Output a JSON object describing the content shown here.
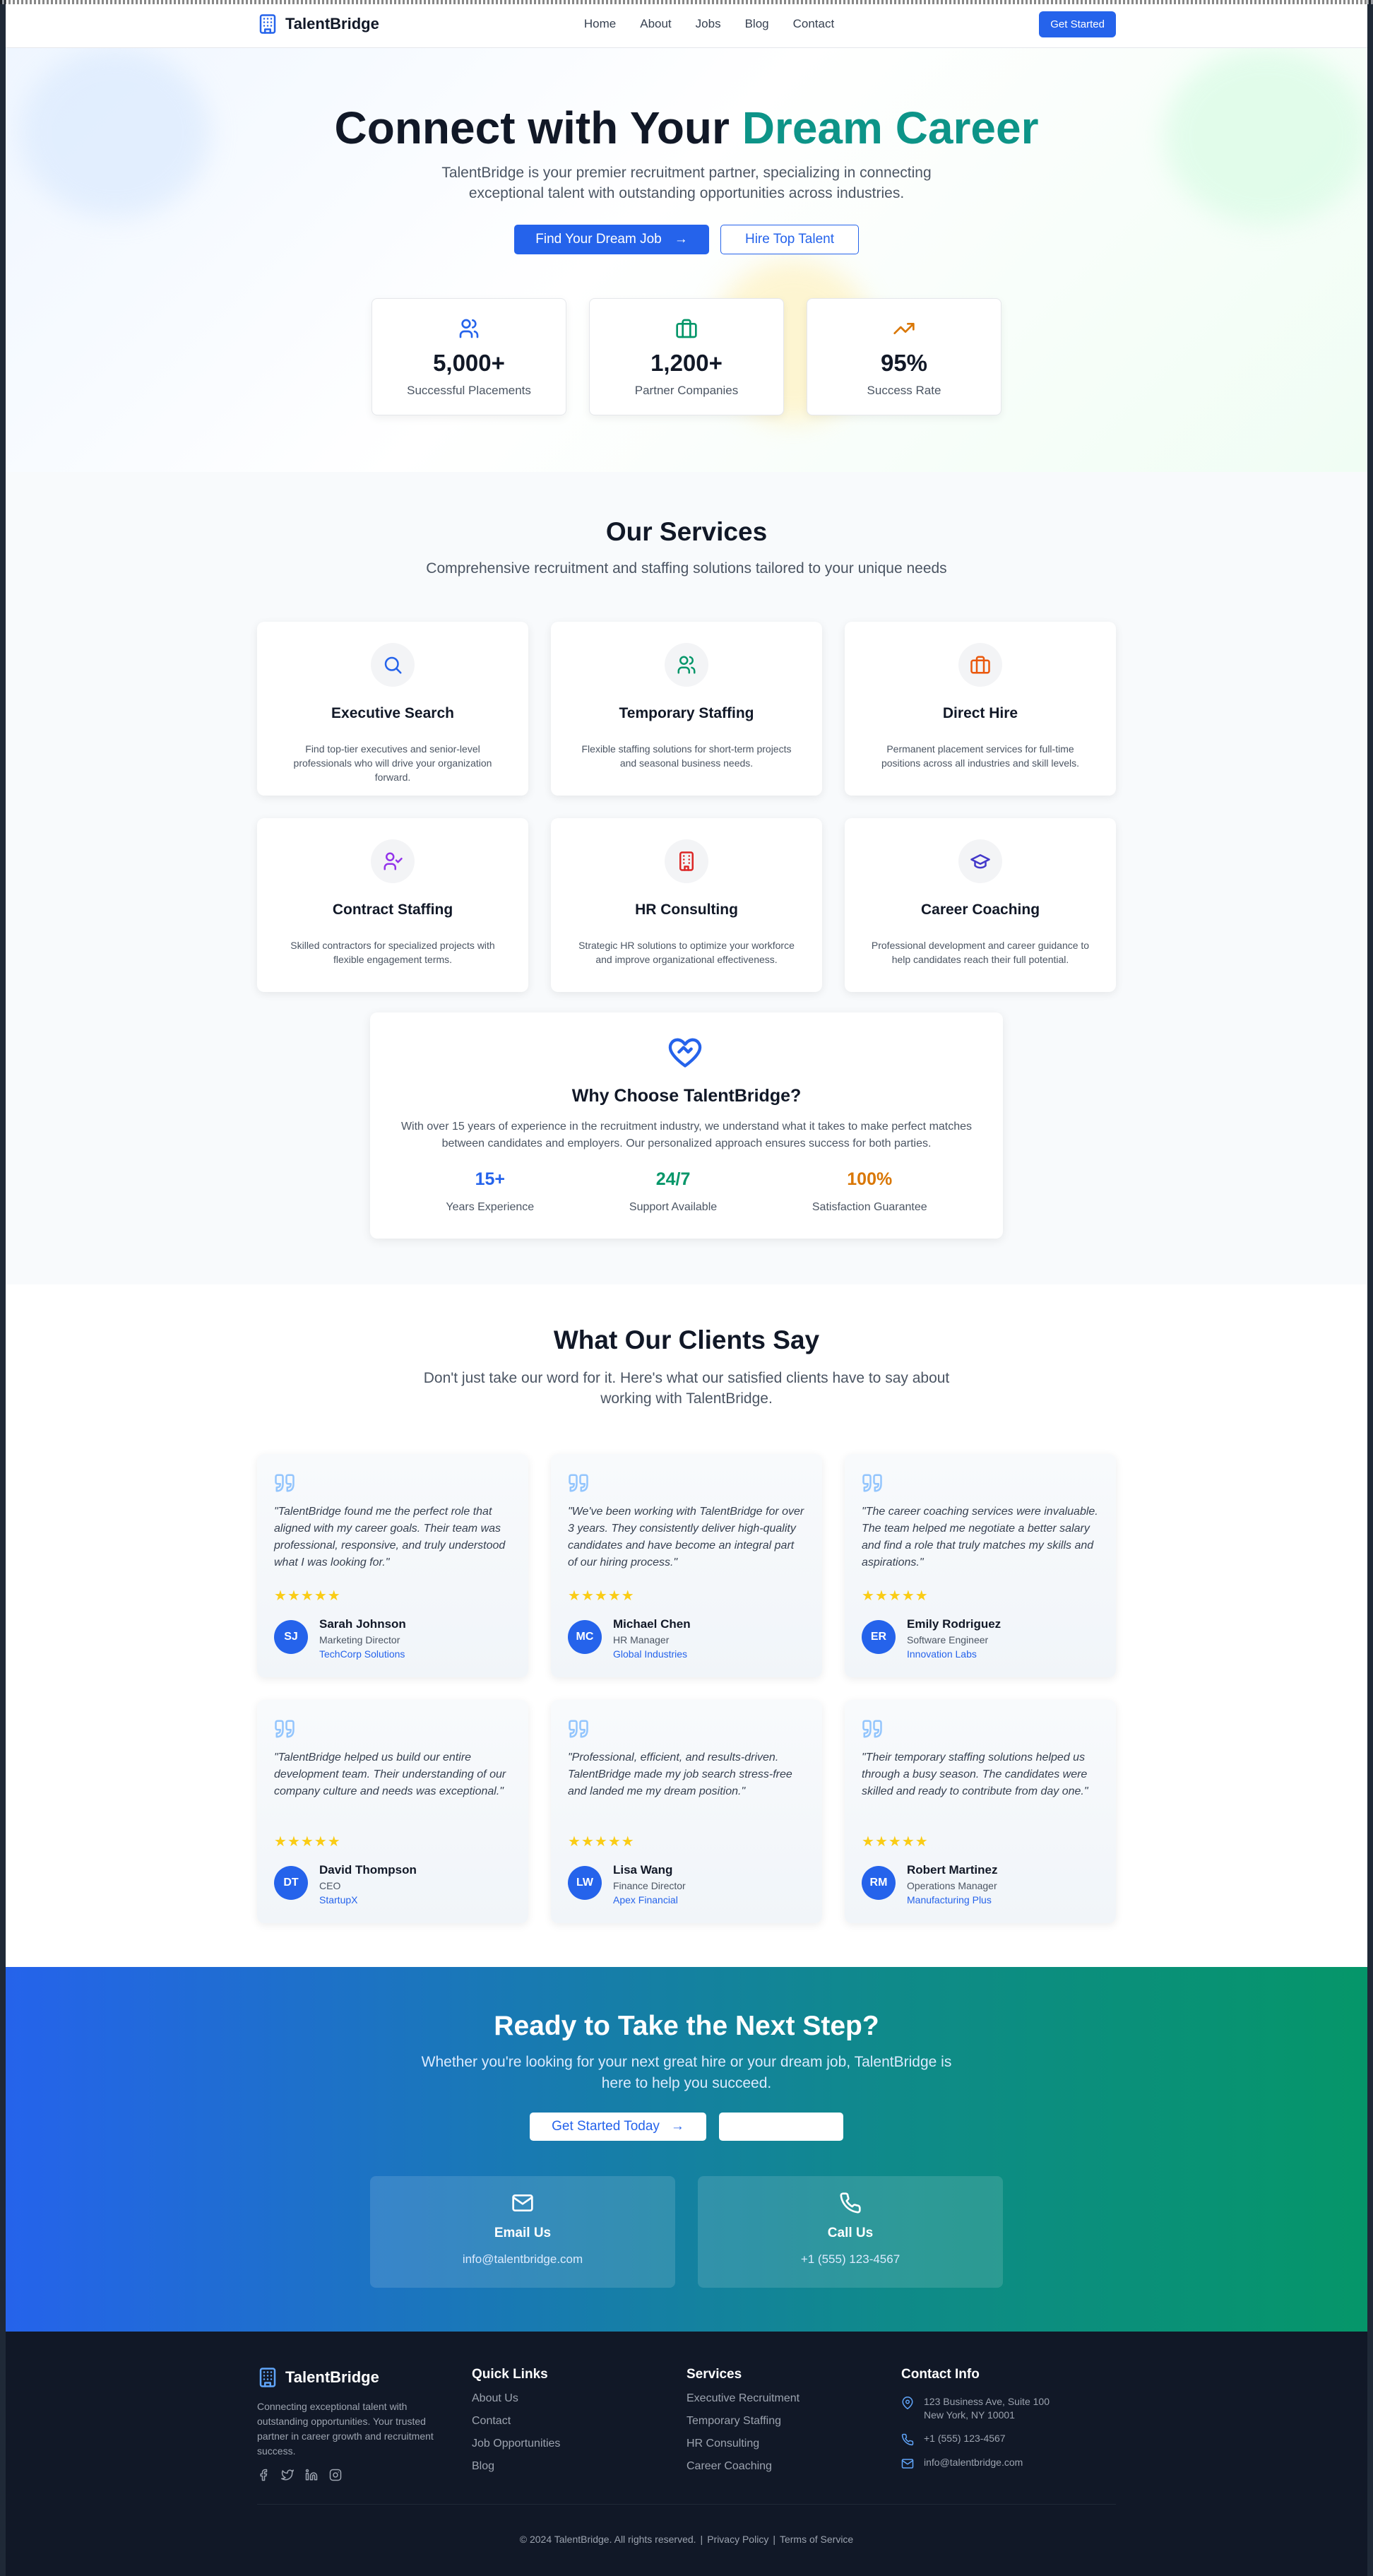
{
  "brand": "TalentBridge",
  "nav": {
    "links": [
      "Home",
      "About",
      "Jobs",
      "Blog",
      "Contact"
    ],
    "cta": "Get Started"
  },
  "hero": {
    "title_prefix": "Connect with Your ",
    "title_accent": "Dream Career",
    "subtitle": "TalentBridge is your premier recruitment partner, specializing in connecting exceptional talent with outstanding opportunities across industries.",
    "primary_cta": "Find Your Dream Job",
    "secondary_cta": "Hire Top Talent",
    "stats": [
      {
        "value": "5,000+",
        "label": "Successful Placements",
        "icon": "users-icon",
        "color": "#2563eb"
      },
      {
        "value": "1,200+",
        "label": "Partner Companies",
        "icon": "briefcase-icon",
        "color": "#059669"
      },
      {
        "value": "95%",
        "label": "Success Rate",
        "icon": "trending-up-icon",
        "color": "#d97706"
      }
    ]
  },
  "services": {
    "title": "Our Services",
    "subtitle": "Comprehensive recruitment and staffing solutions tailored to your unique needs",
    "items": [
      {
        "title": "Executive Search",
        "desc": "Find top-tier executives and senior-level professionals who will drive your organization forward.",
        "icon": "search-icon",
        "color": "#2563eb"
      },
      {
        "title": "Temporary Staffing",
        "desc": "Flexible staffing solutions for short-term projects and seasonal business needs.",
        "icon": "users-icon",
        "color": "#059669"
      },
      {
        "title": "Direct Hire",
        "desc": "Permanent placement services for full-time positions across all industries and skill levels.",
        "icon": "briefcase-icon",
        "color": "#ea580c"
      },
      {
        "title": "Contract Staffing",
        "desc": "Skilled contractors for specialized projects with flexible engagement terms.",
        "icon": "user-check-icon",
        "color": "#9333ea"
      },
      {
        "title": "HR Consulting",
        "desc": "Strategic HR solutions to optimize your workforce and improve organizational effectiveness.",
        "icon": "building-icon",
        "color": "#dc2626"
      },
      {
        "title": "Career Coaching",
        "desc": "Professional development and career guidance to help candidates reach their full potential.",
        "icon": "graduation-cap-icon",
        "color": "#4338ca"
      }
    ],
    "why": {
      "title": "Why Choose TalentBridge?",
      "text": "With over 15 years of experience in the recruitment industry, we understand what it takes to make perfect matches between candidates and employers. Our personalized approach ensures success for both parties.",
      "stats": [
        {
          "value": "15+",
          "label": "Years Experience",
          "color": "#2563eb"
        },
        {
          "value": "24/7",
          "label": "Support Available",
          "color": "#059669"
        },
        {
          "value": "100%",
          "label": "Satisfaction Guarantee",
          "color": "#d97706"
        }
      ]
    }
  },
  "testimonials": {
    "title": "What Our Clients Say",
    "subtitle": "Don't just take our word for it. Here's what our satisfied clients have to say about working with TalentBridge.",
    "items": [
      {
        "quote": "\"TalentBridge found me the perfect role that aligned with my career goals. Their team was professional, responsive, and truly understood what I was looking for.\"",
        "initials": "SJ",
        "name": "Sarah Johnson",
        "role": "Marketing Director",
        "company": "TechCorp Solutions",
        "rating": 5
      },
      {
        "quote": "\"We've been working with TalentBridge for over 3 years. They consistently deliver high-quality candidates and have become an integral part of our hiring process.\"",
        "initials": "MC",
        "name": "Michael Chen",
        "role": "HR Manager",
        "company": "Global Industries",
        "rating": 5
      },
      {
        "quote": "\"The career coaching services were invaluable. The team helped me negotiate a better salary and find a role that truly matches my skills and aspirations.\"",
        "initials": "ER",
        "name": "Emily Rodriguez",
        "role": "Software Engineer",
        "company": "Innovation Labs",
        "rating": 5
      },
      {
        "quote": "\"TalentBridge helped us build our entire development team. Their understanding of our company culture and needs was exceptional.\"",
        "initials": "DT",
        "name": "David Thompson",
        "role": "CEO",
        "company": "StartupX",
        "rating": 5
      },
      {
        "quote": "\"Professional, efficient, and results-driven. TalentBridge made my job search stress-free and landed me my dream position.\"",
        "initials": "LW",
        "name": "Lisa Wang",
        "role": "Finance Director",
        "company": "Apex Financial",
        "rating": 5
      },
      {
        "quote": "\"Their temporary staffing solutions helped us through a busy season. The candidates were skilled and ready to contribute from day one.\"",
        "initials": "RM",
        "name": "Robert Martinez",
        "role": "Operations Manager",
        "company": "Manufacturing Plus",
        "rating": 5
      }
    ]
  },
  "cta": {
    "title": "Ready to Take the Next Step?",
    "subtitle": "Whether you're looking for your next great hire or your dream job, TalentBridge is here to help you succeed.",
    "primary": "Get Started Today",
    "secondary": "",
    "contacts": [
      {
        "title": "Email Us",
        "value": "info@talentbridge.com",
        "icon": "mail-icon"
      },
      {
        "title": "Call Us",
        "value": "+1 (555) 123-4567",
        "icon": "phone-icon"
      }
    ]
  },
  "footer": {
    "description": "Connecting exceptional talent with outstanding opportunities. Your trusted partner in career growth and recruitment success.",
    "quick_links_title": "Quick Links",
    "quick_links": [
      "About Us",
      "Contact",
      "Job Opportunities",
      "Blog"
    ],
    "services_title": "Services",
    "services": [
      "Executive Recruitment",
      "Temporary Staffing",
      "HR Consulting",
      "Career Coaching"
    ],
    "contact_title": "Contact Info",
    "address_line1": "123 Business Ave, Suite 100",
    "address_line2": "New York, NY 10001",
    "phone": "+1 (555) 123-4567",
    "email": "info@talentbridge.com",
    "copyright": "© 2024 TalentBridge. All rights reserved.",
    "privacy": "Privacy Policy",
    "terms": "Terms of Service",
    "social": [
      "facebook-icon",
      "twitter-icon",
      "linkedin-icon",
      "instagram-icon"
    ]
  }
}
